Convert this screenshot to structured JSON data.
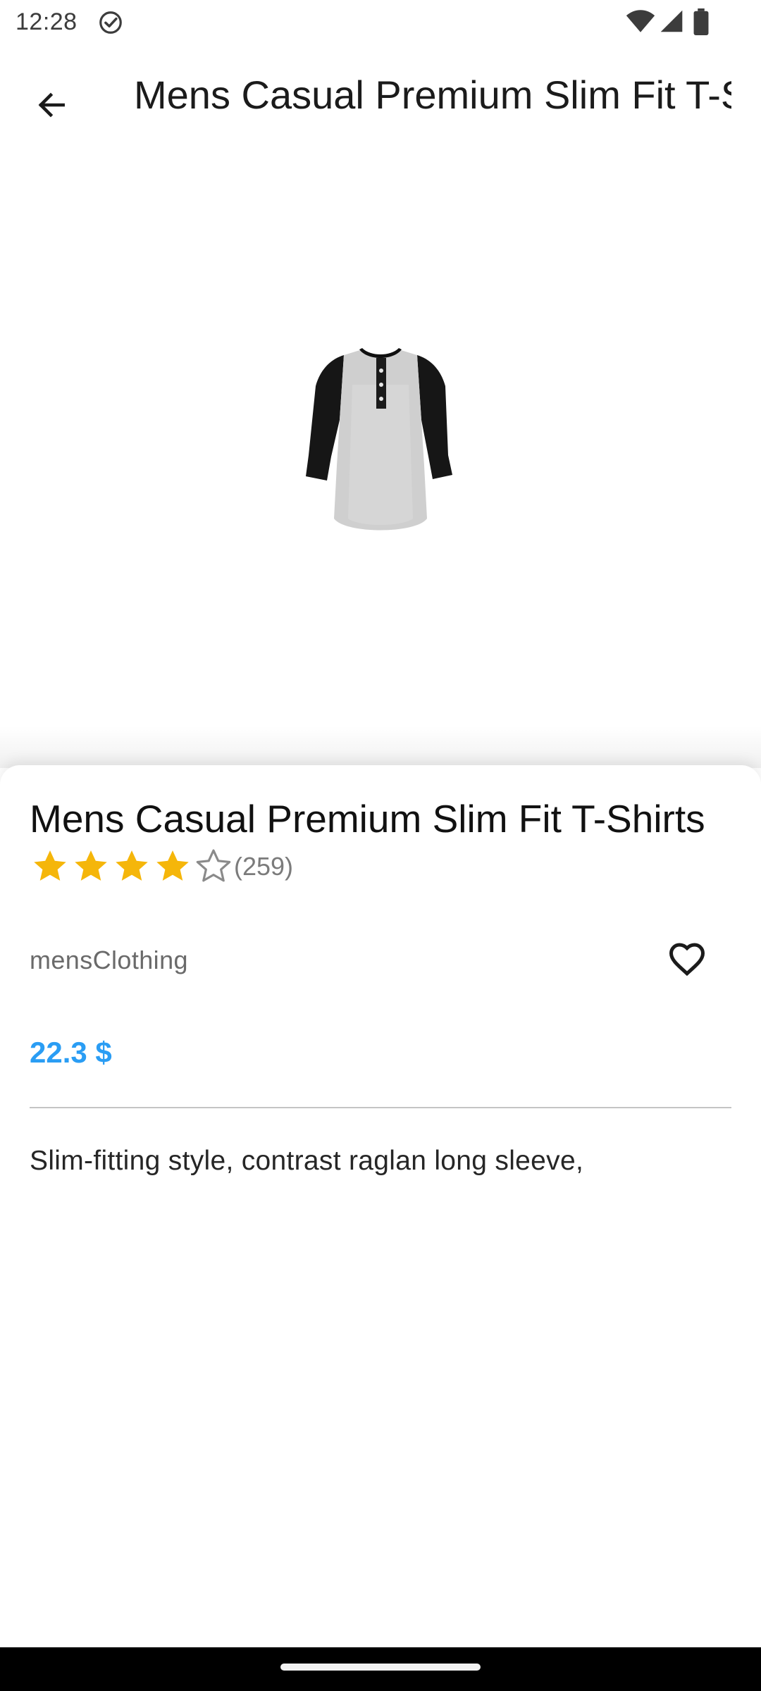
{
  "status_bar": {
    "time": "12:28",
    "icons": [
      "check-circle-icon",
      "wifi-icon",
      "signal-icon",
      "battery-icon"
    ]
  },
  "app_bar": {
    "back_icon": "arrow-left-icon",
    "title": "Mens Casual Premium Slim Fit T-Shirts"
  },
  "product": {
    "image_icon": "raglan-henley-tshirt",
    "title": "Mens Casual Premium Slim Fit T-Shirts",
    "rating": {
      "filled_stars": 4,
      "total_stars": 5,
      "count_text": "(259)"
    },
    "category": "mensClothing",
    "favorite_icon": "heart-outline-icon",
    "price": "22.3 $",
    "description": "Slim-fitting style, contrast raglan long sleeve,"
  },
  "colors": {
    "star_filled": "#F5B60A",
    "star_empty": "#8A8A8A",
    "price": "#2A9DF4",
    "divider": "#C4C4C4",
    "nav_bar": "#000000"
  }
}
